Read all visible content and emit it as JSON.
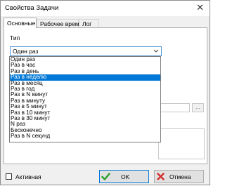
{
  "window": {
    "title": "Свойства Задачи",
    "close_glyph": "✕"
  },
  "tabs": [
    {
      "label": "Основные"
    },
    {
      "label": "Рабочее время"
    },
    {
      "label": "Лог"
    }
  ],
  "type_label": "Тип",
  "combo": {
    "value": "Один раз",
    "arrow_icon": "chevron-down-icon"
  },
  "dropdown": {
    "selected_index": 3,
    "options": [
      "Один раз",
      "Раз в час",
      "Раз в день",
      "Раз в неделю",
      "Раз в месяц",
      "Раз в год",
      "Раз в N минут",
      "Раз в минуту",
      "Раз в 5 минут",
      "Раз в 10 минут",
      "Раз в 30 минут",
      "N раз",
      "Бесконечно",
      "Раз в N секунд"
    ]
  },
  "browse_button": {
    "label": "..."
  },
  "active_checkbox": {
    "label": "Активная",
    "checked": false
  },
  "buttons": {
    "ok": {
      "label": "OK",
      "icon": "check-icon",
      "color": "#2e9e2e"
    },
    "cancel": {
      "label": "Отмена",
      "icon": "x-icon",
      "color": "#d32f2f"
    }
  },
  "colors": {
    "selection": "#0078d7",
    "focus_border": "#5a9bd8"
  }
}
